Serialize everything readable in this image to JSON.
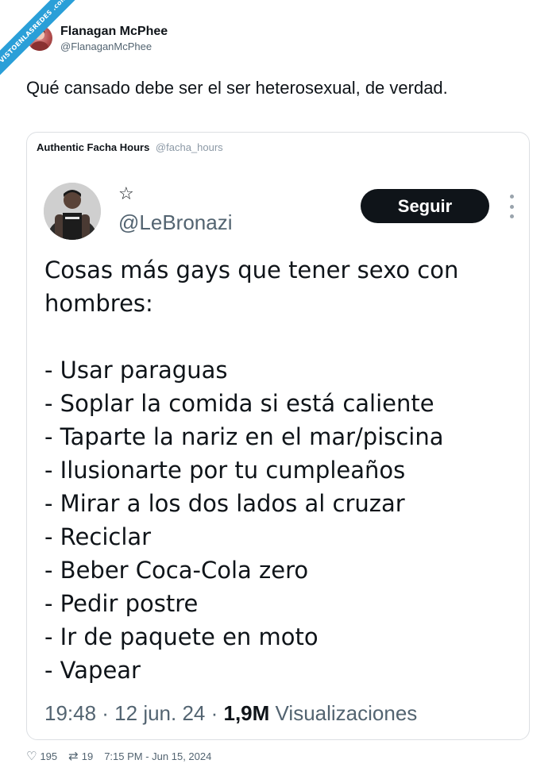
{
  "watermark": "VISTOENLASREDES .com",
  "outer_tweet": {
    "author_name": "Flanagan McPhee",
    "author_handle": "@FlanaganMcPhee",
    "text": "Qué cansado debe ser el ser heterosexual, de verdad."
  },
  "quote": {
    "author_name": "Authentic Facha Hours",
    "author_handle": "@facha_hours",
    "inner_tweet": {
      "star_icon": "star-outline-icon",
      "handle": "@LeBronazi",
      "follow_label": "Seguir",
      "body_lines": [
        "Cosas más gays que tener sexo con",
        "hombres:",
        "",
        "- Usar paraguas",
        "- Soplar la comida si está caliente",
        "- Taparte la nariz en el mar/piscina",
        "- Ilusionarte por tu cumpleaños",
        "- Mirar a los dos lados al cruzar",
        "- Reciclar",
        "- Beber Coca-Cola zero",
        "- Pedir postre",
        "- Ir de paquete en moto",
        "- Vapear"
      ],
      "meta_time": "19:48 · 12 jun. 24 ·",
      "meta_views_count": "1,9M",
      "meta_views_label": "Visualizaciones"
    }
  },
  "footer": {
    "likes": "195",
    "retweets": "19",
    "timestamp": "7:15 PM - Jun 15, 2024"
  },
  "colors": {
    "accent_dark": "#0f1419",
    "muted": "#536471",
    "watermark": "#2a9fd8"
  }
}
